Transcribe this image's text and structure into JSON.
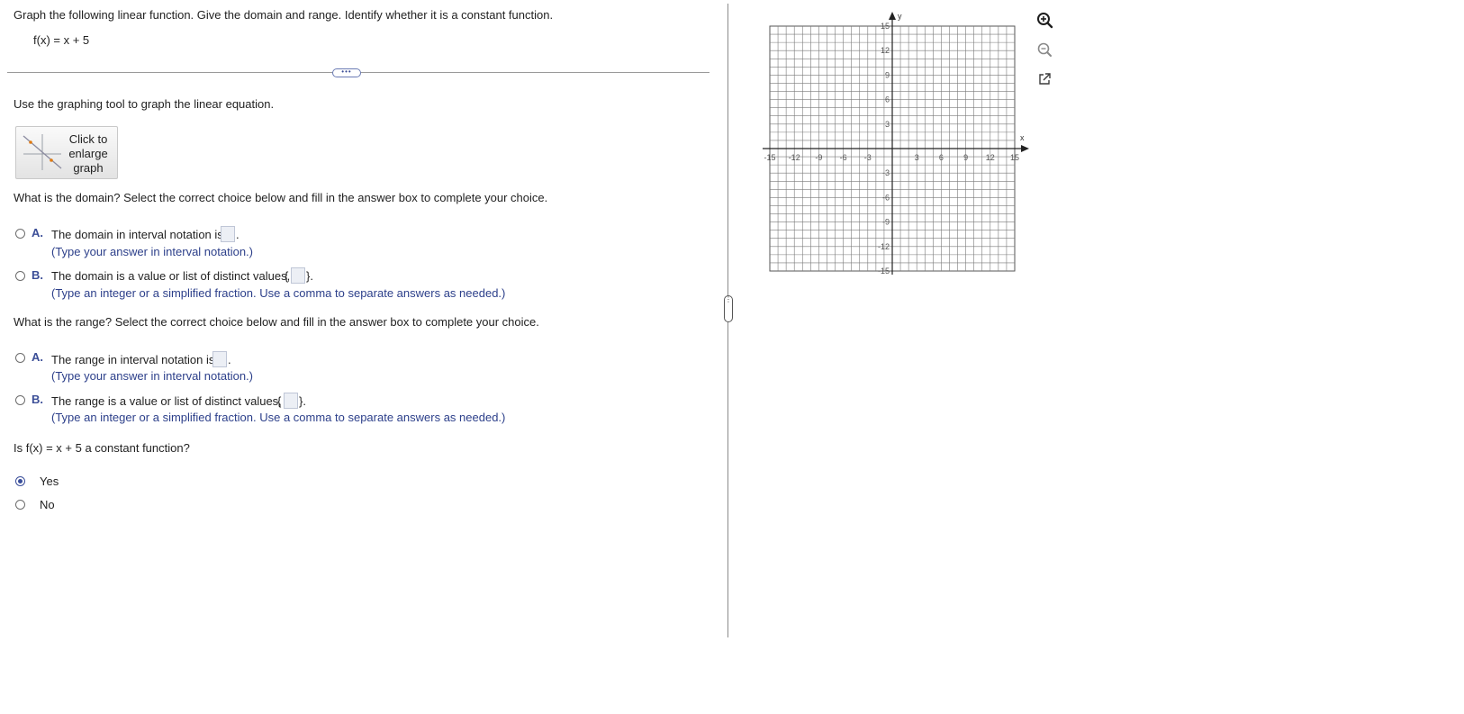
{
  "question": {
    "instruction": "Graph the following linear function. Give the domain and range. Identify whether it is a constant function.",
    "function": "f(x) = x + 5",
    "separator_dots": "•••"
  },
  "graph_prompt": "Use the graphing tool to graph the linear equation.",
  "enlarge_button": {
    "label": "Click to enlarge graph"
  },
  "domain": {
    "prompt": "What is the domain? Select the correct choice below and fill in the answer box to complete your choice.",
    "option_a": {
      "letter": "A.",
      "text": "The domain in interval notation is",
      "end": ".",
      "hint": "(Type your answer in interval notation.)",
      "value": ""
    },
    "option_b": {
      "letter": "B.",
      "text": "The domain is a value or list of distinct values,",
      "brace_open": "{",
      "brace_close": "}.",
      "hint": "(Type an integer or a simplified fraction. Use a comma to separate answers as needed.)",
      "value": ""
    }
  },
  "range": {
    "prompt": "What is the range? Select the correct choice below and fill in the answer box to complete your choice.",
    "option_a": {
      "letter": "A.",
      "text": "The range in interval notation is",
      "end": ".",
      "hint": "(Type your answer in interval notation.)",
      "value": ""
    },
    "option_b": {
      "letter": "B.",
      "text": "The range is a value or list of distinct values,",
      "brace_open": "{",
      "brace_close": "}.",
      "hint": "(Type an integer or a simplified fraction. Use a comma to separate answers as needed.)",
      "value": ""
    }
  },
  "constant": {
    "prompt": "Is f(x) = x + 5 a constant function?",
    "options": [
      "Yes",
      "No"
    ],
    "selected": "Yes"
  },
  "graph": {
    "x_axis_label": "x",
    "y_axis_label": "y",
    "x_min": -15,
    "x_max": 15,
    "y_min": -15,
    "y_max": 15,
    "tick_step": 3,
    "x_tick_labels": [
      "-15",
      "-12",
      "-9",
      "-6",
      "-3",
      "3",
      "6",
      "9",
      "12",
      "15"
    ],
    "y_tick_labels": [
      "15",
      "12",
      "9",
      "6",
      "3",
      "-3",
      "-6",
      "-9",
      "-12",
      "-15"
    ],
    "grid": true
  },
  "tools": {
    "zoom_in_icon": "zoom-in-icon",
    "zoom_out_icon": "zoom-out-icon",
    "popout_icon": "popout-icon"
  },
  "colors": {
    "accent": "#3a4e9a",
    "answer_box": "#eceff5",
    "grid_line": "#7a7a7a"
  }
}
